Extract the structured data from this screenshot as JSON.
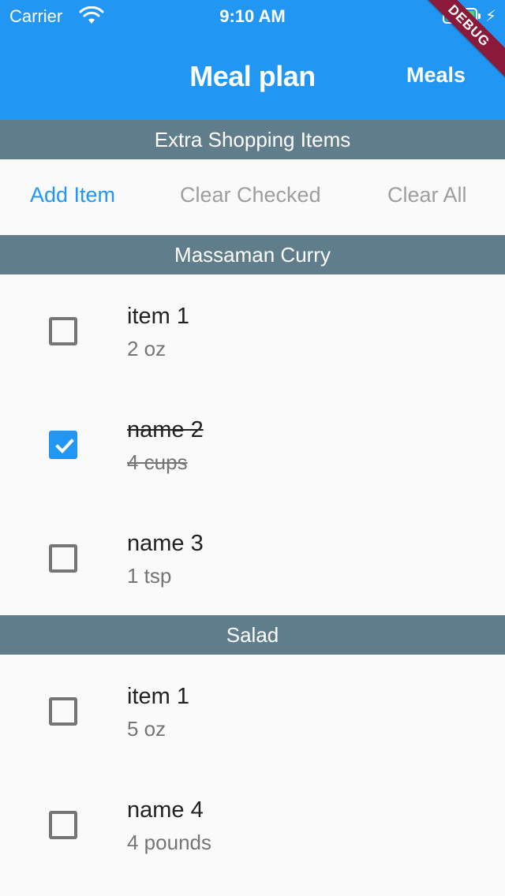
{
  "status_bar": {
    "carrier": "Carrier",
    "time": "9:10 AM"
  },
  "app_bar": {
    "title": "Meal plan",
    "action_label": "Meals"
  },
  "debug_banner": "DEBUG",
  "extra_section": {
    "title": "Extra Shopping Items",
    "actions": {
      "add": "Add Item",
      "clear_checked": "Clear Checked",
      "clear_all": "Clear All"
    }
  },
  "meals": [
    {
      "title": "Massaman Curry",
      "items": [
        {
          "name": "item 1",
          "qty": "2 oz",
          "checked": false
        },
        {
          "name": "name 2",
          "qty": "4 cups",
          "checked": true
        },
        {
          "name": "name 3",
          "qty": "1 tsp",
          "checked": false
        }
      ]
    },
    {
      "title": "Salad",
      "items": [
        {
          "name": "item 1",
          "qty": "5 oz",
          "checked": false
        },
        {
          "name": "name 4",
          "qty": "4 pounds",
          "checked": false
        }
      ]
    }
  ],
  "colors": {
    "primary": "#2196f3",
    "section_header": "#607d8b",
    "debug": "#8b1a3a",
    "battery": "#4cd964"
  }
}
